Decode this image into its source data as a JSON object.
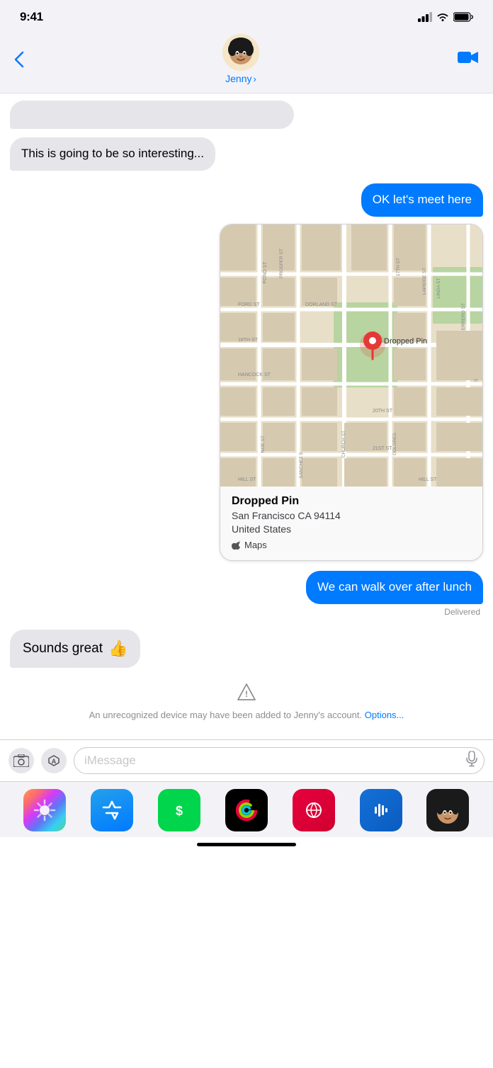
{
  "statusBar": {
    "time": "9:41"
  },
  "navBar": {
    "backLabel": "‹",
    "contactName": "Jenny",
    "chevron": "›",
    "avatarEmoji": "👩🏾‍🦱"
  },
  "messages": [
    {
      "id": "msg1",
      "type": "incoming-partial",
      "text": "..."
    },
    {
      "id": "msg2",
      "type": "incoming",
      "text": "This is going to be so interesting..."
    },
    {
      "id": "msg3",
      "type": "outgoing",
      "text": "OK let's meet here"
    },
    {
      "id": "msg4",
      "type": "map",
      "title": "Dropped Pin",
      "address": "San Francisco CA 94114\nUnited States",
      "source": "Maps"
    },
    {
      "id": "msg5",
      "type": "outgoing",
      "text": "We can walk over after lunch"
    },
    {
      "id": "msg6",
      "type": "delivered",
      "text": "Delivered"
    },
    {
      "id": "msg7",
      "type": "incoming",
      "text": "Sounds great 👍"
    }
  ],
  "warning": {
    "text": "An unrecognized device may have been added to Jenny's account.",
    "linkText": "Options..."
  },
  "inputArea": {
    "cameraIcon": "📷",
    "appsIcon": "A",
    "placeholder": "iMessage",
    "micIcon": "🎤"
  },
  "dock": {
    "apps": [
      {
        "name": "Photos",
        "emoji": "🌸"
      },
      {
        "name": "App Store",
        "emoji": ""
      },
      {
        "name": "Cash",
        "emoji": ""
      },
      {
        "name": "Fitness",
        "emoji": ""
      },
      {
        "name": "Translate",
        "emoji": ""
      },
      {
        "name": "Shazam",
        "emoji": ""
      },
      {
        "name": "Memoji",
        "emoji": ""
      }
    ]
  },
  "map": {
    "streets": [
      "POND ST",
      "PROSPER ST",
      "FORD ST",
      "DORLAND ST",
      "18TH ST",
      "HANCOCK ST",
      "20TH ST",
      "21ST ST",
      "HILL ST",
      "CHURCH ST",
      "SANCHEZ ST",
      "DOLORES",
      "NOE ST",
      "ERRERO ST",
      "LAPIDGE ST",
      "LINDA ST",
      "17TH ST"
    ],
    "pinLabel": "Dropped Pin"
  }
}
